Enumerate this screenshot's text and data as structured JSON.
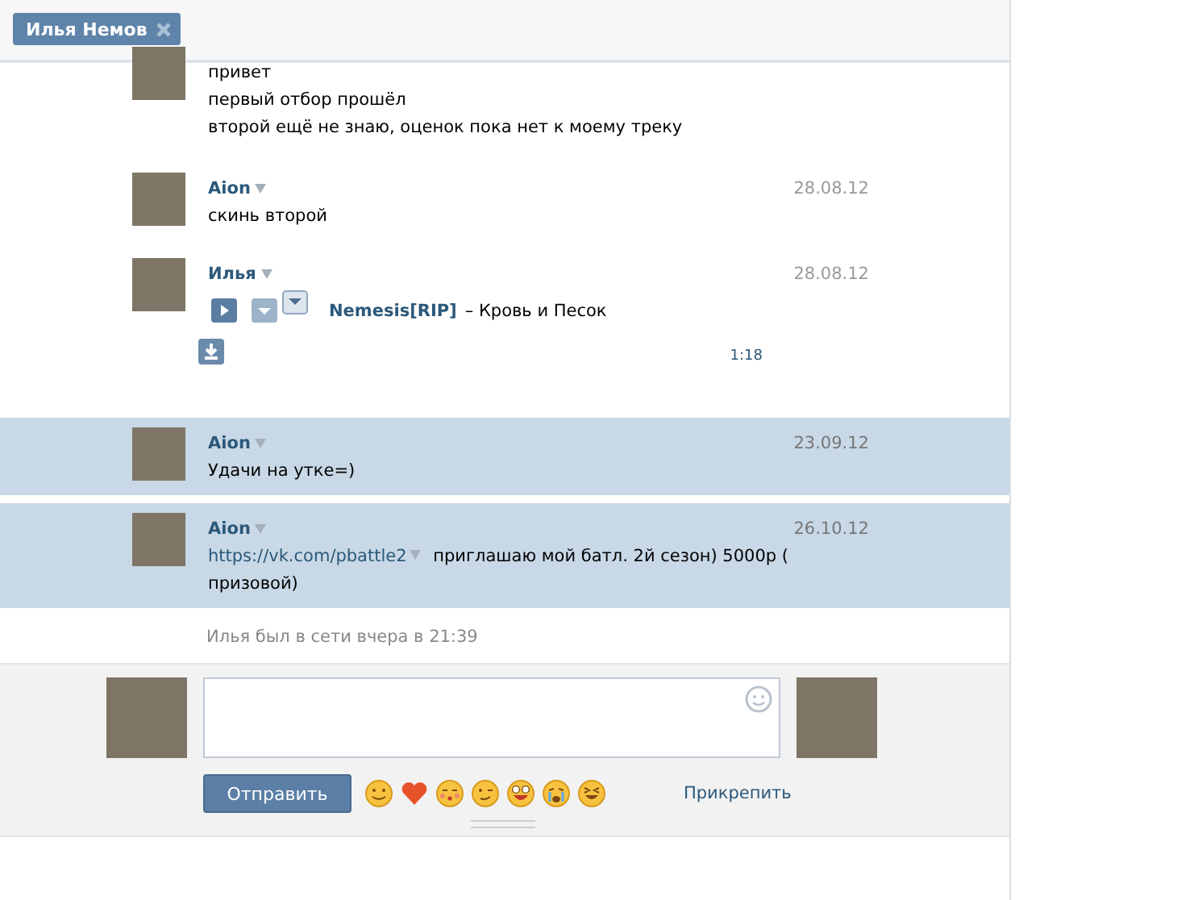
{
  "tab": {
    "label": "Илья Немов"
  },
  "messages": [
    {
      "kind": "text",
      "selected": false,
      "lines": [
        "привет",
        "первый отбор прошёл",
        "второй ещё не знаю, оценок пока нет к моему треку"
      ]
    },
    {
      "kind": "text",
      "author": "Aion",
      "date": "28.08.12",
      "selected": false,
      "lines": [
        "скинь второй"
      ]
    },
    {
      "kind": "audio",
      "author": "Илья",
      "date": "28.08.12",
      "selected": false,
      "audio": {
        "artist": "Nemesis[RIP]",
        "title": "– Кровь и Песок",
        "duration": "1:18"
      }
    },
    {
      "kind": "text",
      "author": "Aion",
      "date": "23.09.12",
      "selected": true,
      "lines": [
        "Удачи на утке=)"
      ]
    },
    {
      "kind": "link",
      "author": "Aion",
      "date": "26.10.12",
      "selected": true,
      "link": "https://vk.com/pbattle2",
      "text": "приглашаю мой батл. 2й сезон) 5000р ( призовой)"
    }
  ],
  "status": "Илья был в сети вчера в 21:39",
  "composer": {
    "send_button": "Отправить",
    "attach_link": "Прикрепить"
  }
}
